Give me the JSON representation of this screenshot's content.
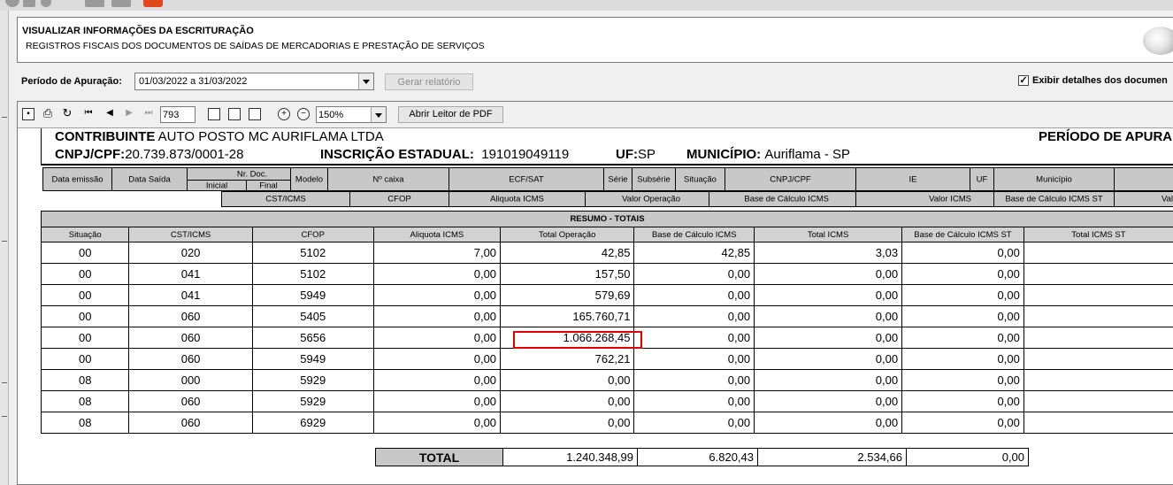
{
  "header": {
    "title": "VISUALIZAR INFORMAÇÕES DA ESCRITURAÇÃO",
    "subtitle": "REGISTROS FISCAIS DOS DOCUMENTOS DE SAÍDAS DE MERCADORIAS E PRESTAÇÃO DE SERVIÇOS"
  },
  "filters": {
    "period_label": "Período de Apuração:",
    "period_value": "01/03/2022 a 31/03/2022",
    "report_button": "Gerar relatório",
    "details_checked": "✓",
    "details_label": "Exibir detalhes dos documen"
  },
  "viewer": {
    "page_number": "793",
    "zoom": "150%",
    "pdf_button": "Abrir Leitor de PDF"
  },
  "report": {
    "contrib_label": "CONTRIBUINTE",
    "contrib_value": "AUTO POSTO MC AURIFLAMA LTDA",
    "periodo_label": "PERÍODO DE APURA",
    "cnpj_label": "CNPJ/CPF:",
    "cnpj_value": "20.739.873/0001-28",
    "ie_label": "INSCRIÇÃO ESTADUAL:",
    "ie_value": "191019049119",
    "uf_label": "UF:",
    "uf_value": "SP",
    "mun_label": "MUNICÍPIO:",
    "mun_value": "Auriflama - SP"
  },
  "grid_headers": {
    "data_emissao": "Data emissão",
    "data_saida": "Data Saída",
    "nr_doc": "Nr. Doc.",
    "inicial": "Inicial",
    "final": "Final",
    "modelo": "Modelo",
    "n_caixa": "Nº caixa",
    "ecf_sat": "ECF/SAT",
    "serie": "Série",
    "subserie": "Subsérie",
    "situacao": "Situação",
    "cnpj_cpf": "CNPJ/CPF",
    "ie": "IE",
    "uf": "UF",
    "municipio": "Município",
    "cst_icms": "CST/ICMS",
    "cfop": "CFOP",
    "aliquota": "Aliquota ICMS",
    "valor_operacao": "Valor Operação",
    "base_calculo": "Base de Cálculo ICMS",
    "valor_icms": "Valor ICMS",
    "base_st": "Base de Cálculo ICMS ST",
    "val_trunc": "Val"
  },
  "summary": {
    "title": "RESUMO - TOTAIS",
    "columns": [
      "Situação",
      "CST/ICMS",
      "CFOP",
      "Aliquota ICMS",
      "Total Operação",
      "Base de Cálculo ICMS",
      "Total ICMS",
      "Base de Cálculo ICMS ST",
      "Total ICMS ST"
    ],
    "rows": [
      [
        "00",
        "020",
        "5102",
        "7,00",
        "42,85",
        "42,85",
        "3,03",
        "0,00"
      ],
      [
        "00",
        "041",
        "5102",
        "0,00",
        "157,50",
        "0,00",
        "0,00",
        "0,00"
      ],
      [
        "00",
        "041",
        "5949",
        "0,00",
        "579,69",
        "0,00",
        "0,00",
        "0,00"
      ],
      [
        "00",
        "060",
        "5405",
        "0,00",
        "165.760,71",
        "0,00",
        "0,00",
        "0,00"
      ],
      [
        "00",
        "060",
        "5656",
        "0,00",
        "1.066.268,45",
        "0,00",
        "0,00",
        "0,00"
      ],
      [
        "00",
        "060",
        "5949",
        "0,00",
        "762,21",
        "0,00",
        "0,00",
        "0,00"
      ],
      [
        "08",
        "000",
        "5929",
        "0,00",
        "0,00",
        "0,00",
        "0,00",
        "0,00"
      ],
      [
        "08",
        "060",
        "5929",
        "0,00",
        "0,00",
        "0,00",
        "0,00",
        "0,00"
      ],
      [
        "08",
        "060",
        "6929",
        "0,00",
        "0,00",
        "0,00",
        "0,00",
        "0,00"
      ]
    ],
    "total_label": "TOTAL",
    "totals": [
      "1.240.348,99",
      "6.820,43",
      "2.534,66",
      "0,00"
    ]
  }
}
